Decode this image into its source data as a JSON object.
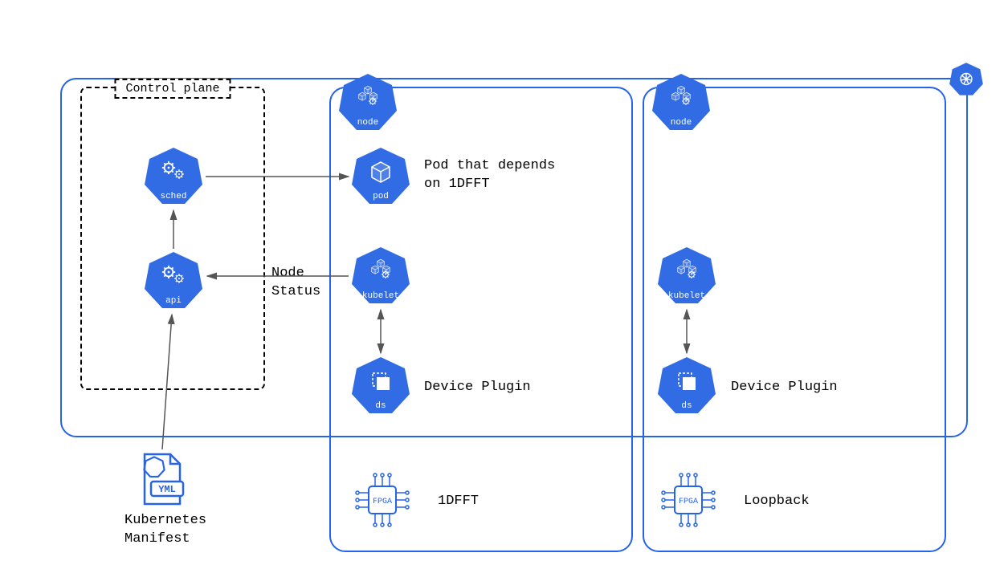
{
  "controlPlane": {
    "label": "Control plane"
  },
  "components": {
    "sched": "sched",
    "api": "api",
    "node1": "node",
    "node2": "node",
    "pod": "pod",
    "kubelet1": "kubelet",
    "kubelet2": "kubelet",
    "ds1": "ds",
    "ds2": "ds"
  },
  "labels": {
    "podDep": "Pod that depends\non 1DFFT",
    "nodeStatus": "Node\nStatus",
    "devicePlugin1": "Device Plugin",
    "devicePlugin2": "Device Plugin",
    "fpga1": "1DFFT",
    "fpga2": "Loopback",
    "manifest": "Kubernetes\nManifest",
    "yml": "YML",
    "fpgaChip": "FPGA"
  },
  "colors": {
    "k8sBlue": "#326ce5",
    "border": "#2563eb",
    "arrow": "#555555"
  }
}
